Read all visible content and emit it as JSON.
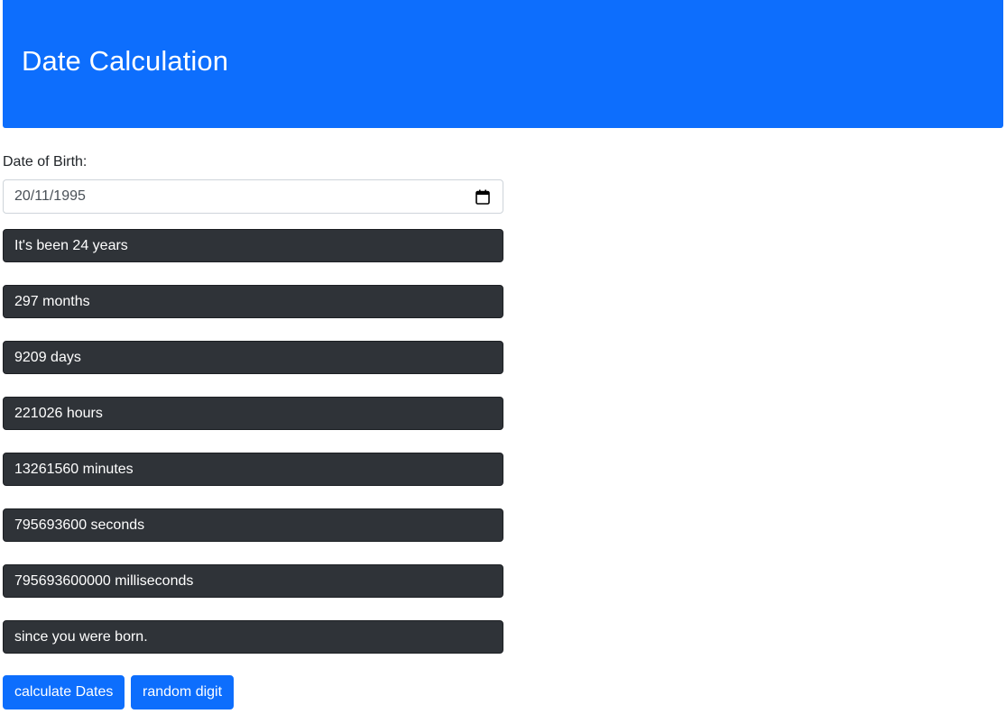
{
  "header": {
    "title": "Date Calculation"
  },
  "form": {
    "dob_label": "Date of Birth:",
    "dob_value": "20/11/1995",
    "calendar_icon": "calendar-icon"
  },
  "results": [
    "It's been 24 years",
    "297 months",
    "9209 days",
    "221026 hours",
    "13261560 minutes",
    "795693600 seconds",
    "795693600000 milliseconds",
    "since you were born."
  ],
  "buttons": {
    "calculate_label": "calculate Dates",
    "random_label": "random digit"
  },
  "colors": {
    "primary": "#0d6efd",
    "result_bg": "#2f3338"
  }
}
